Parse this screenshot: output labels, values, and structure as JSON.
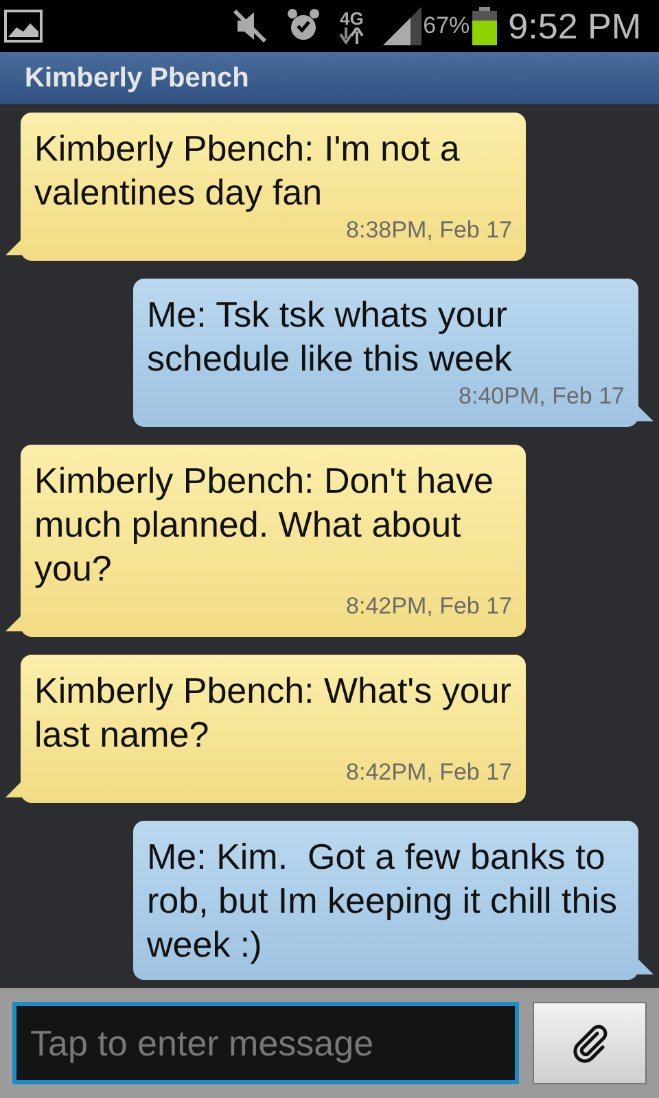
{
  "status_bar": {
    "network": "4G",
    "battery": "67%",
    "time": "9:52 PM"
  },
  "title_bar": {
    "title": "Kimberly Pbench"
  },
  "messages": [
    {
      "kind": "incoming",
      "text": "Kimberly Pbench: I'm not a valentines day fan",
      "time": "8:38PM, Feb 17"
    },
    {
      "kind": "outgoing",
      "text": "Me: Tsk tsk whats your schedule like this week",
      "time": "8:40PM, Feb 17"
    },
    {
      "kind": "incoming",
      "text": "Kimberly Pbench: Don't have much planned. What about you?",
      "time": "8:42PM, Feb 17"
    },
    {
      "kind": "incoming",
      "text": "Kimberly Pbench: What's your last name?",
      "time": "8:42PM, Feb 17"
    },
    {
      "kind": "outgoing",
      "text": "Me: Kim.  Got a few banks to rob, but Im keeping it chill this week :)"
    }
  ],
  "composer": {
    "placeholder": "Tap to enter message"
  }
}
